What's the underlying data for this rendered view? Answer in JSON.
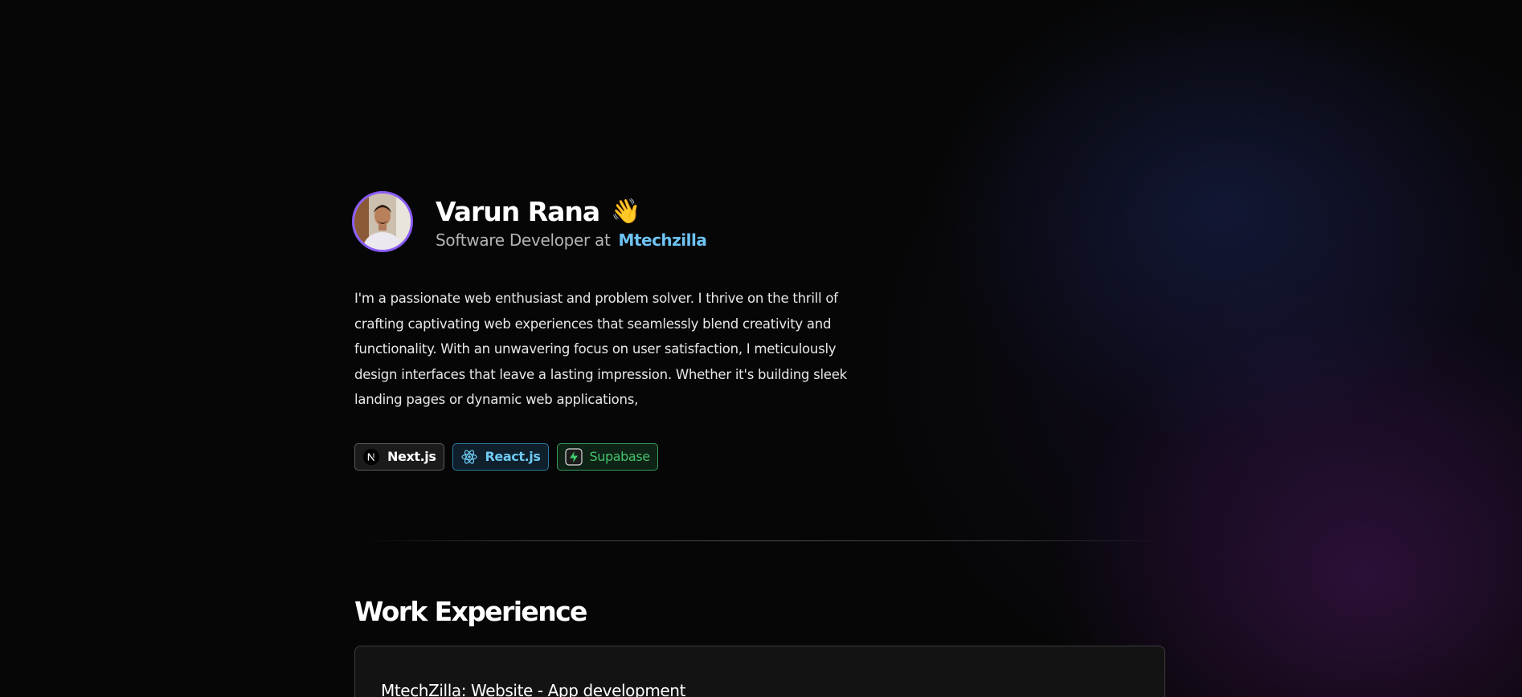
{
  "profile": {
    "name": "Varun Rana",
    "wave_emoji": "👋",
    "role": "Software Developer at",
    "company": "Mtechzilla"
  },
  "bio": "I'm a passionate web enthusiast and problem solver. I thrive on the thrill of crafting captivating web experiences that seamlessly blend creativity and functionality. With an unwavering focus on user satisfaction, I meticulously design interfaces that leave a lasting impression. Whether it's building sleek landing pages or dynamic web applications,",
  "tech_tags": [
    {
      "label": "Next.js",
      "icon": "nextjs-icon",
      "color": "#ffffff"
    },
    {
      "label": "React.js",
      "icon": "react-icon",
      "color": "#6ec9f2"
    },
    {
      "label": "Supabase",
      "icon": "supabase-icon",
      "color": "#45c26c"
    }
  ],
  "work_experience": {
    "title": "Work Experience",
    "items": [
      {
        "title": "MtechZilla: Website - App development"
      }
    ]
  },
  "colors": {
    "background": "#060606",
    "accent_company": "#6ec3f5",
    "avatar_border": "#8a5cf6"
  }
}
